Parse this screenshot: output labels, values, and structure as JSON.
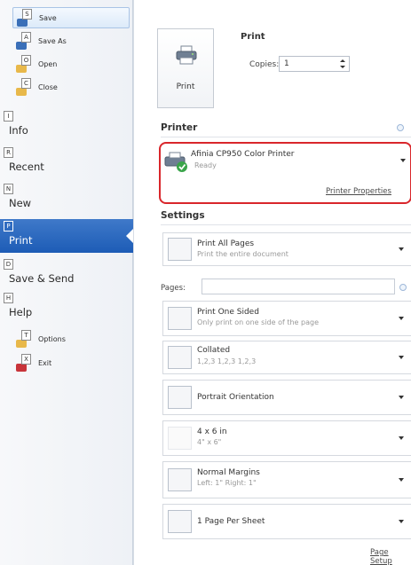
{
  "sidebar": {
    "save": {
      "key": "S",
      "label": "Save"
    },
    "save_as": {
      "key": "A",
      "label": "Save As"
    },
    "open": {
      "key": "O",
      "label": "Open"
    },
    "close": {
      "key": "C",
      "label": "Close"
    },
    "info": {
      "key": "I",
      "label": "Info"
    },
    "recent": {
      "key": "R",
      "label": "Recent"
    },
    "new": {
      "key": "N",
      "label": "New"
    },
    "print": {
      "key": "P",
      "label": "Print"
    },
    "save_send": {
      "key": "D",
      "label": "Save & Send"
    },
    "help": {
      "key": "H",
      "label": "Help"
    },
    "options": {
      "key": "T",
      "label": "Options"
    },
    "exit": {
      "key": "X",
      "label": "Exit"
    }
  },
  "print": {
    "heading": "Print",
    "button_label": "Print",
    "copies_label": "Copies:",
    "copies_value": "1"
  },
  "printer": {
    "heading": "Printer",
    "name": "Afinia CP950 Color Printer",
    "status": "Ready",
    "properties_link": "Printer Properties"
  },
  "settings": {
    "heading": "Settings",
    "print_what": {
      "title": "Print All Pages",
      "subtitle": "Print the entire document"
    },
    "pages_label": "Pages:",
    "pages_value": "",
    "sides": {
      "title": "Print One Sided",
      "subtitle": "Only print on one side of the page"
    },
    "collation": {
      "title": "Collated",
      "subtitle": "1,2,3   1,2,3   1,2,3"
    },
    "orientation": {
      "title": "Portrait Orientation"
    },
    "paper": {
      "title": "4 x 6 in",
      "subtitle": "4\" x 6\""
    },
    "margins": {
      "title": "Normal Margins",
      "subtitle": "Left: 1\"   Right: 1\""
    },
    "pages_per_sheet": {
      "title": "1 Page Per Sheet"
    },
    "page_setup_link": "Page Setup"
  },
  "colors": {
    "accent": "#1d5cb6",
    "highlight_border": "#d9262b",
    "ready_green": "#3aa54a"
  }
}
